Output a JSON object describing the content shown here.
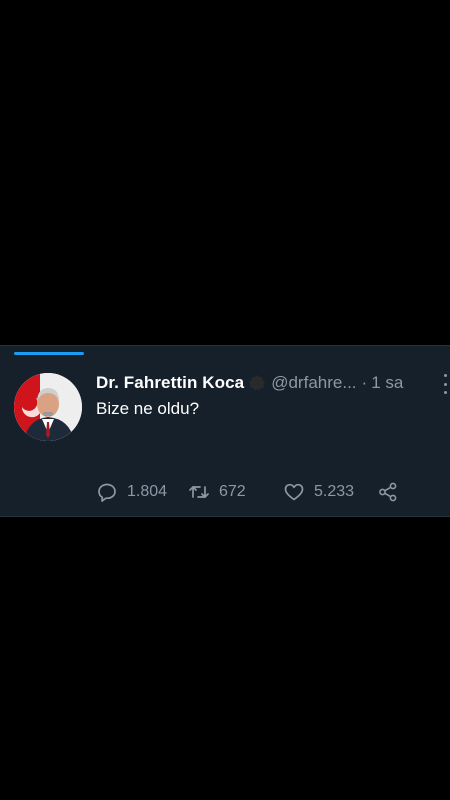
{
  "tweet": {
    "display_name": "Dr. Fahrettin Koca",
    "handle": "@drfahre...",
    "separator": "·",
    "time": "1 sa",
    "text": "Bize ne oldu?",
    "replies": "1.804",
    "retweets": "672",
    "likes": "5.233"
  },
  "icons": {
    "badge": "verified-badge-icon",
    "more": "more-vertical-icon",
    "reply": "reply-icon",
    "retweet": "retweet-icon",
    "like": "heart-icon",
    "share": "share-icon"
  },
  "colors": {
    "card_background": "#15202b",
    "primary_text": "#ffffff",
    "secondary_text": "#8b98a5",
    "accent": "#1d9bf0"
  }
}
